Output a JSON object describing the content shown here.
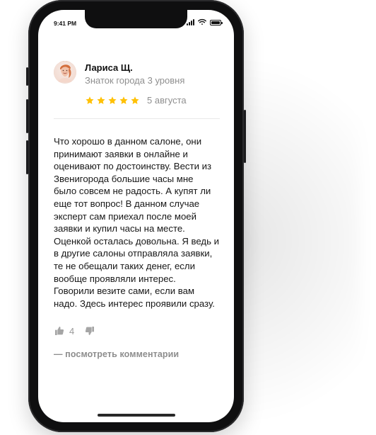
{
  "status_bar": {
    "time": "9:41 PM"
  },
  "reviewer": {
    "name": "Лариса Щ.",
    "level": "Знаток города 3 уровня",
    "avatar_icon": "avatar"
  },
  "rating": {
    "stars": 5,
    "max": 5,
    "color": "#FFC107",
    "date": "5 августа"
  },
  "review": {
    "text": "Что хорошо в данном салоне, они\nпринимают заявки в онлайне и\nоценивают по достоинству. Вести из\nЗвенигорода большие часы мне\nбыло совсем не радость. А купят ли\nеще тот вопрос! В данном случае\nэксперт сам приехал после моей\nзаявки и купил часы на месте.\nОценкой осталась довольна. Я ведь и\nв другие салоны отправляла заявки,\nте не обещали таких денег, если\nвообще проявляли интерес.\nГоворили везите сами, если вам\nнадо. Здесь интерес проявили сразу."
  },
  "reactions": {
    "likes": "4",
    "like_icon": "thumbs-up-icon",
    "dislike_icon": "thumbs-down-icon"
  },
  "comments": {
    "link_label": "— посмотреть комментарии"
  }
}
